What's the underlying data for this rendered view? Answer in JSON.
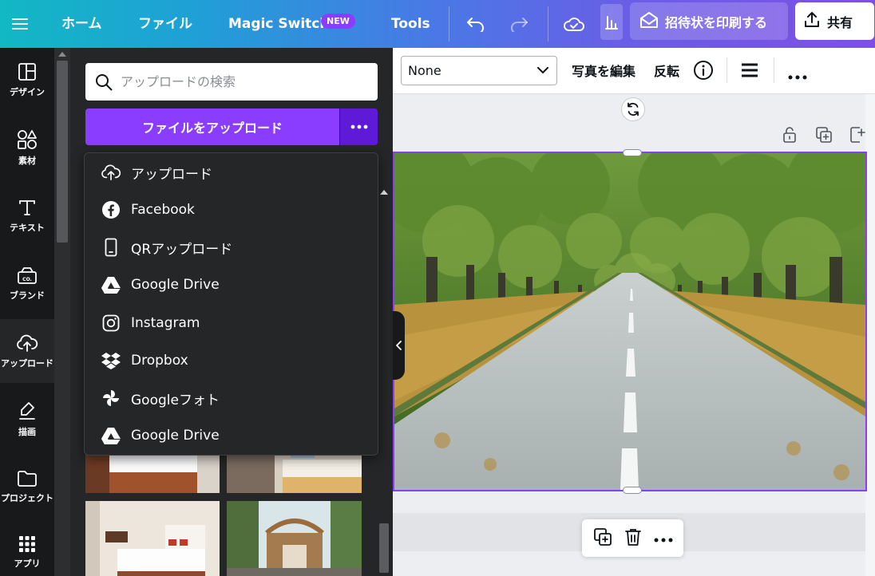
{
  "topbar": {
    "home": "ホーム",
    "file": "ファイル",
    "magic_switch": "Magic Switch",
    "new_badge": "NEW",
    "tools": "Tools",
    "print_invites": "招待状を印刷する",
    "share": "共有"
  },
  "rail": {
    "items": [
      {
        "label": "デザイン",
        "icon": "layout-icon"
      },
      {
        "label": "素材",
        "icon": "elements-icon"
      },
      {
        "label": "テキスト",
        "icon": "text-icon"
      },
      {
        "label": "ブランド",
        "icon": "brand-icon"
      },
      {
        "label": "アップロード",
        "icon": "cloud-upload-icon"
      },
      {
        "label": "描画",
        "icon": "draw-icon"
      },
      {
        "label": "プロジェクト",
        "icon": "folder-icon"
      },
      {
        "label": "アプリ",
        "icon": "apps-grid-icon"
      }
    ]
  },
  "panel": {
    "search_placeholder": "アップロードの検索",
    "upload_button": "ファイルをアップロード",
    "menu": [
      {
        "label": "アップロード",
        "icon": "cloud-upload-icon"
      },
      {
        "label": "Facebook",
        "icon": "facebook-icon"
      },
      {
        "label": "QRアップロード",
        "icon": "phone-icon"
      },
      {
        "label": "Google Drive",
        "icon": "google-drive-icon"
      },
      {
        "label": "Instagram",
        "icon": "instagram-icon"
      },
      {
        "label": "Dropbox",
        "icon": "dropbox-icon"
      },
      {
        "label": "Googleフォト",
        "icon": "google-photos-icon"
      },
      {
        "label": "Google Drive",
        "icon": "google-drive-icon"
      }
    ]
  },
  "context_bar": {
    "filter_select": "None",
    "edit_photo": "写真を編集",
    "flip": "反転"
  },
  "colors": {
    "accent": "#8b3dff",
    "rail_bg": "#18191b",
    "panel_bg": "#252627"
  }
}
